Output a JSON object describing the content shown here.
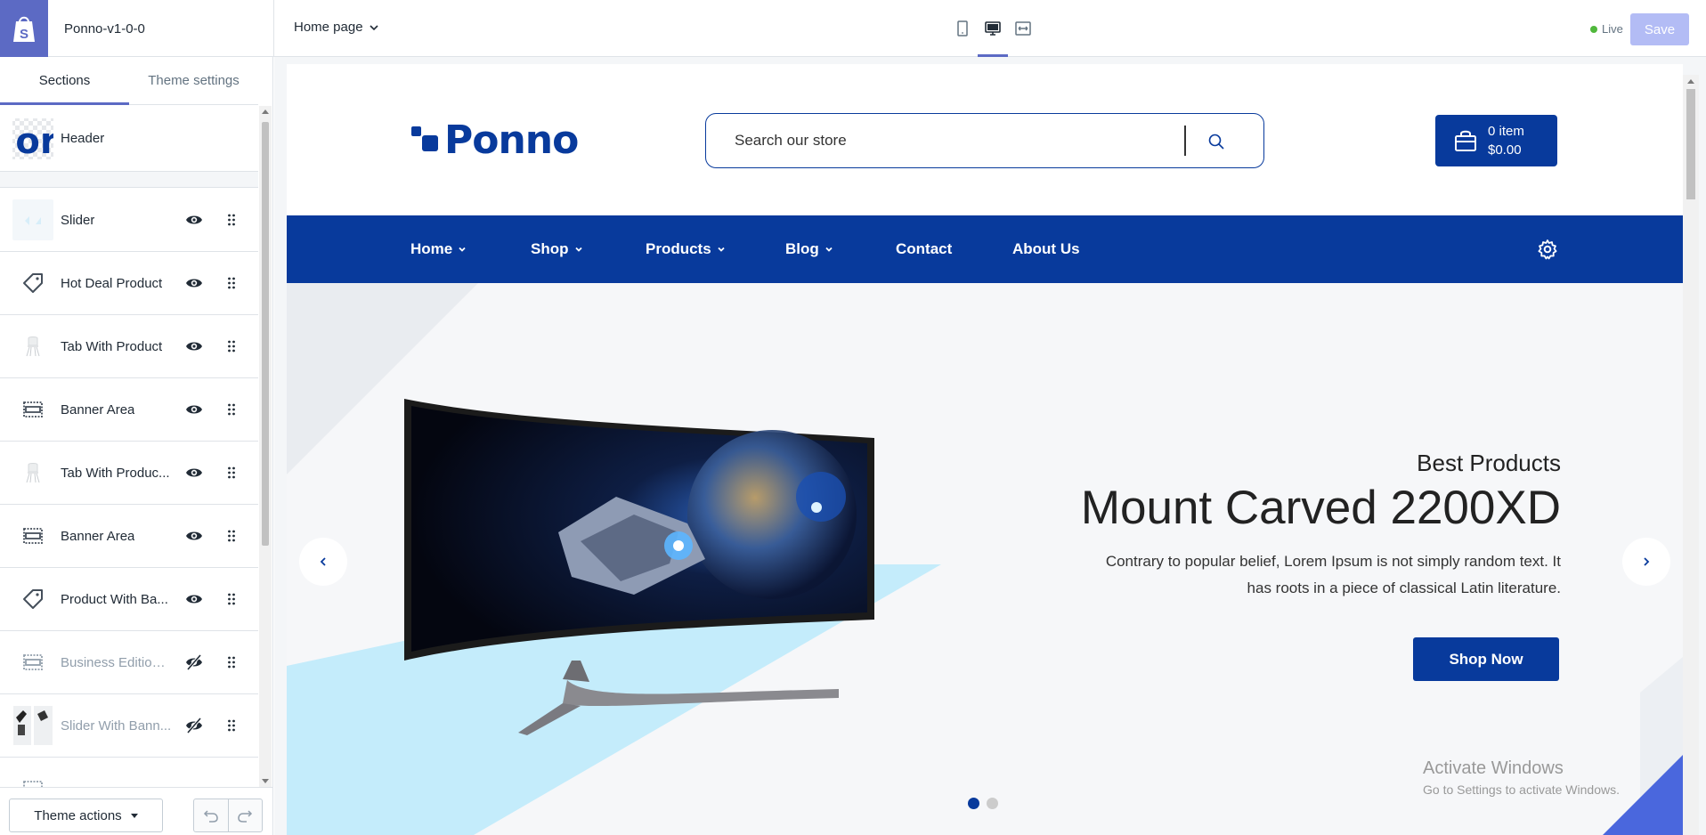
{
  "topbar": {
    "theme_name": "Ponno-v1-0-0",
    "page_select": "Home page",
    "live_label": "Live",
    "save_label": "Save"
  },
  "sidebar": {
    "tabs": [
      {
        "label": "Sections",
        "active": true
      },
      {
        "label": "Theme settings",
        "active": false
      }
    ],
    "header_item": {
      "label": "Header",
      "thumb_text": "or"
    },
    "items": [
      {
        "label": "Slider",
        "icon": "slider-thumb-icon",
        "visible": true
      },
      {
        "label": "Hot Deal Product",
        "icon": "tag-icon",
        "visible": true
      },
      {
        "label": "Tab With Product",
        "icon": "chair-thumb-icon",
        "visible": true
      },
      {
        "label": "Banner Area",
        "icon": "banner-icon",
        "visible": true
      },
      {
        "label": "Tab With Produc...",
        "icon": "chair-thumb-icon",
        "visible": true
      },
      {
        "label": "Banner Area",
        "icon": "banner-icon",
        "visible": true
      },
      {
        "label": "Product With Ba...",
        "icon": "tag-icon",
        "visible": true
      },
      {
        "label": "Business Edition ...",
        "icon": "banner-icon",
        "visible": false
      },
      {
        "label": "Slider With Bann...",
        "icon": "slider-banner-thumb-icon",
        "visible": false
      }
    ],
    "footer": {
      "theme_actions_label": "Theme actions"
    }
  },
  "store": {
    "logo_text": "Ponno",
    "search_placeholder": "Search our store",
    "cart": {
      "count": "0 item",
      "total": "$0.00"
    },
    "nav": [
      {
        "label": "Home",
        "dropdown": true
      },
      {
        "label": "Shop",
        "dropdown": true
      },
      {
        "label": "Products",
        "dropdown": true
      },
      {
        "label": "Blog",
        "dropdown": true
      },
      {
        "label": "Contact",
        "dropdown": false
      },
      {
        "label": "About Us",
        "dropdown": false
      }
    ],
    "hero": {
      "kicker": "Best Products",
      "title": "Mount Carved 2200XD",
      "description": "Contrary to popular belief, Lorem Ipsum is not simply random text. It has roots in a piece of classical Latin literature.",
      "cta": "Shop Now",
      "active_slide": 1,
      "slide_count": 2
    },
    "watermark": {
      "title": "Activate Windows",
      "subtitle": "Go to Settings to activate Windows."
    }
  },
  "colors": {
    "brand": "#083a9c",
    "shopify_purple": "#5c6ac4",
    "save_disabled": "#b3bcf5",
    "live_green": "#50b83c",
    "accent_light_blue": "#c4ecfb"
  }
}
